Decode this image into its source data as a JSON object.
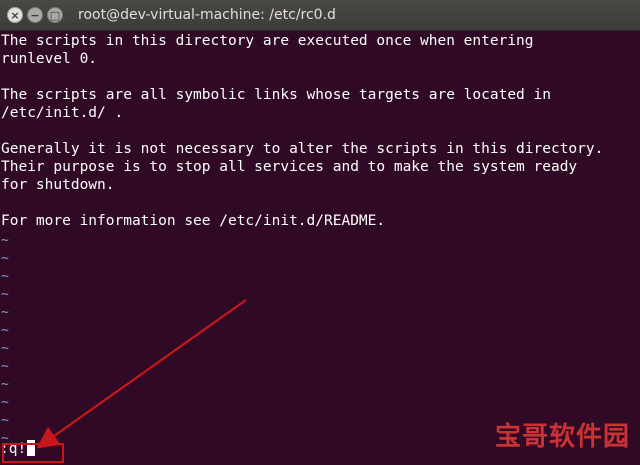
{
  "window": {
    "title": "root@dev-virtual-machine: /etc/rc0.d",
    "close_glyph": "×",
    "minimize_glyph": "−",
    "maximize_glyph": "□"
  },
  "terminal": {
    "lines": [
      "The scripts in this directory are executed once when entering",
      "runlevel 0.",
      "",
      "The scripts are all symbolic links whose targets are located in",
      "/etc/init.d/ .",
      "",
      "Generally it is not necessary to alter the scripts in this directory.",
      "Their purpose is to stop all services and to make the system ready",
      "for shutdown.",
      "",
      "For more information see /etc/init.d/README."
    ],
    "tilde": "~",
    "command": ":q!"
  },
  "watermark": "宝哥软件园",
  "colors": {
    "terminal_bg": "#300a24",
    "tilde": "#7f9cd8",
    "annotation": "#c7171c"
  }
}
